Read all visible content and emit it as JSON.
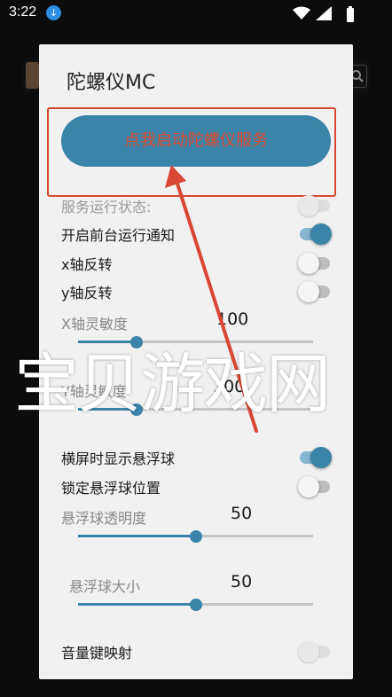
{
  "status_bar": {
    "time": "3:22"
  },
  "dialog": {
    "title": "陀螺仪MC",
    "start_button": "点我启动陀螺仪服务",
    "service_status_label": "服务运行状态:",
    "toggles": [
      {
        "label": "开启前台运行通知",
        "state": "on"
      },
      {
        "label": "x轴反转",
        "state": "off"
      },
      {
        "label": "y轴反转",
        "state": "off"
      }
    ],
    "sliders_top": [
      {
        "label": "X轴灵敏度",
        "value": "100",
        "level_fraction": 0.25
      },
      {
        "label": "Y轴灵敏度",
        "value": "100",
        "level_fraction": 0.25
      }
    ],
    "toggles_bottom": [
      {
        "label": "横屏时显示悬浮球",
        "state": "on"
      },
      {
        "label": "锁定悬浮球位置",
        "state": "off"
      }
    ],
    "sliders_bottom": [
      {
        "label": "悬浮球透明度",
        "value": "50",
        "level_fraction": 0.5
      },
      {
        "label": "悬浮球大小",
        "value": "50",
        "level_fraction": 0.5
      }
    ],
    "volume_key_label": "音量键映射"
  },
  "watermark": "宝贝游戏网",
  "colors": {
    "accent": "#3a83a9",
    "annotation_red": "#d94634"
  },
  "icons": [
    "download-icon",
    "wifi-icon",
    "signal-icon",
    "battery-icon",
    "search-icon"
  ]
}
